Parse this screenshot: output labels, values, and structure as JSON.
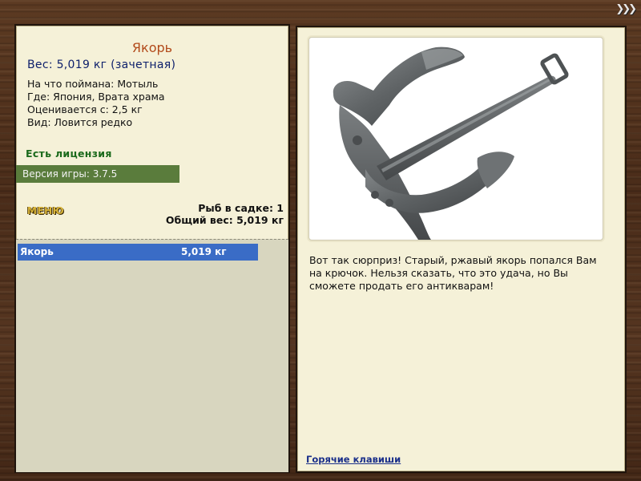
{
  "corner_nav": "❯❯❯",
  "item": {
    "title": "Якорь",
    "weight_line": "Вес: 5,019 кг (зачетная)",
    "caught_on": "На что поймана: Мотыль",
    "location": "Где: Япония, Врата храма",
    "valued_from": "Оценивается с: 2,5 кг",
    "kind": "Вид: Ловится редко",
    "license": "Есть лицензия",
    "version": "Версия игры: 3.7.5"
  },
  "menu_label": "МЕНЮ",
  "cage": {
    "count_line": "Рыб в садке: 1",
    "total_weight_line": "Общий вес: 5,019 кг"
  },
  "catch_list": [
    {
      "name": "Якорь",
      "weight": "5,019 кг"
    }
  ],
  "image": {
    "icon": "anchor-icon",
    "alt": "Якорь"
  },
  "description": "Вот так сюрприз! Старый, ржавый якорь попался Вам на крючок. Нельзя сказать, что это удача, но Вы сможете продать его антикварам!",
  "hotkeys_label": "Горячие клавиши"
}
